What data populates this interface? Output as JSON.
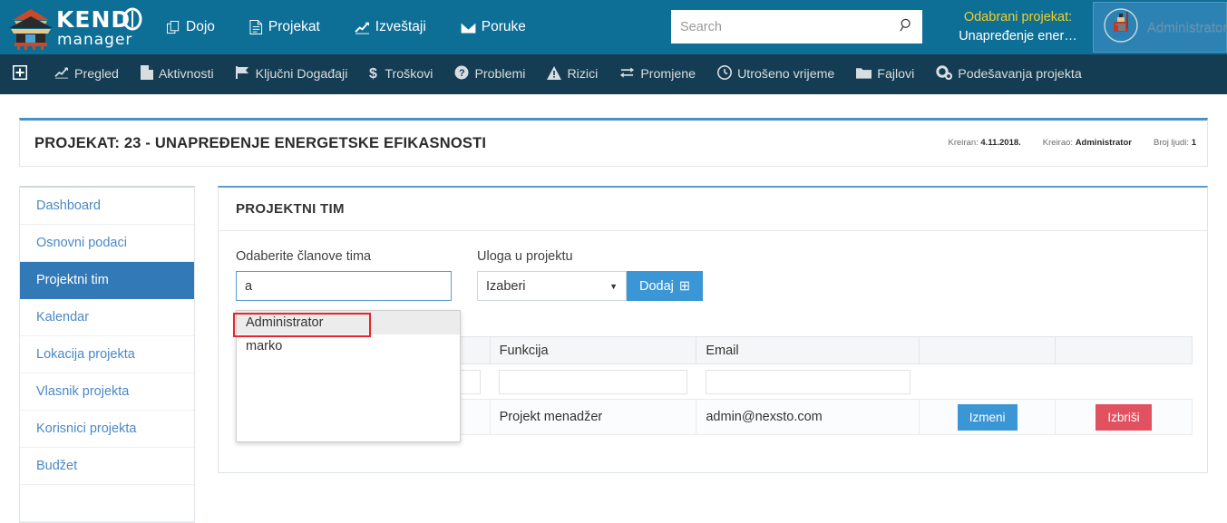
{
  "header": {
    "logo_text_top": "KENDO",
    "logo_text_bottom": "manager",
    "nav": [
      {
        "label": "Dojo",
        "icon": "copy-icon"
      },
      {
        "label": "Projekat",
        "icon": "document-icon"
      },
      {
        "label": "Izveštaji",
        "icon": "chart-line-icon"
      },
      {
        "label": "Poruke",
        "icon": "envelope-icon"
      }
    ],
    "search": {
      "placeholder": "Search",
      "value": "",
      "icon": "search-icon"
    },
    "project_selector": {
      "label": "Odabrani projekat:",
      "value": "Unapređenje ener…",
      "label_color": "#f2d024"
    },
    "user": {
      "name": "Administrator",
      "avatar": "kendo-warrior-avatar"
    }
  },
  "subnav": {
    "items": [
      {
        "label": "",
        "icon": "plus-square-icon"
      },
      {
        "label": "Pregled",
        "icon": "chart-line-icon"
      },
      {
        "label": "Aktivnosti",
        "icon": "file-icon"
      },
      {
        "label": "Ključni Događaji",
        "icon": "flag-icon"
      },
      {
        "label": "Troškovi",
        "icon": "dollar-icon"
      },
      {
        "label": "Problemi",
        "icon": "question-circle-icon"
      },
      {
        "label": "Rizici",
        "icon": "warning-triangle-icon"
      },
      {
        "label": "Promjene",
        "icon": "exchange-icon"
      },
      {
        "label": "Utrošeno vrijeme",
        "icon": "clock-icon"
      },
      {
        "label": "Fajlovi",
        "icon": "folder-icon"
      },
      {
        "label": "Podešavanja projekta",
        "icon": "gears-icon"
      }
    ]
  },
  "project_title": {
    "text": "PROJEKAT: 23 - UNAPREĐENJE ENERGETSKE EFIKASNOSTI",
    "meta": {
      "created_label": "Kreiran:",
      "created_value": "4.11.2018.",
      "creator_label": "Kreirao:",
      "creator_value": "Administrator",
      "people_label": "Broj ljudi:",
      "people_value": "1"
    }
  },
  "sidebar": {
    "items": [
      {
        "label": "Dashboard",
        "active": false
      },
      {
        "label": "Osnovni podaci",
        "active": false
      },
      {
        "label": "Projektni tim",
        "active": true
      },
      {
        "label": "Kalendar",
        "active": false
      },
      {
        "label": "Lokacija projekta",
        "active": false
      },
      {
        "label": "Vlasnik projekta",
        "active": false
      },
      {
        "label": "Korisnici projekta",
        "active": false
      },
      {
        "label": "Budžet",
        "active": false
      }
    ]
  },
  "panel": {
    "title": "PROJEKTNI TIM",
    "form": {
      "member_label": "Odaberite članove tima",
      "member_value": "a",
      "role_label": "Uloga u projektu",
      "role_value": "Izaberi",
      "add_button": "Dodaj",
      "add_button_icon": "plus-square-icon"
    },
    "autocomplete": {
      "options": [
        {
          "label": "Administrator",
          "highlighted": true
        },
        {
          "label": "marko",
          "highlighted": false
        }
      ],
      "annotation_color": "#e8252a"
    },
    "table": {
      "headers": [
        "",
        "Funkcija",
        "Email",
        "",
        ""
      ],
      "filter_row": {
        "name": "",
        "funkcija": "",
        "email": ""
      },
      "rows": [
        {
          "name": "",
          "funkcija": "Projekt menadžer",
          "email": "admin@nexsto.com",
          "edit_label": "Izmeni",
          "delete_label": "Izbriši"
        }
      ]
    }
  },
  "colors": {
    "header_bg": "#0d6e96",
    "subnav_bg": "#143c52",
    "accent_blue": "#3a96d4",
    "sidebar_active": "#3279b8",
    "danger_red": "#e2515f",
    "link_blue": "#4a88c7"
  }
}
